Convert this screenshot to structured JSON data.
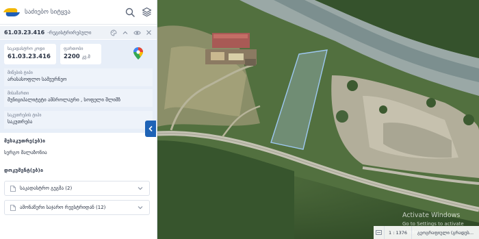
{
  "search": {
    "placeholder": "საძიებო სიტყვა"
  },
  "parcel": {
    "code": "61.03.23.416",
    "type": "-რეგისტრირებული"
  },
  "cards": {
    "cadastral_label": "საკადასტრო კოდი",
    "cadastral_value": "61.03.23.416",
    "area_label": "ფართობი",
    "area_value": "2200",
    "area_unit": "კვ.მ"
  },
  "details": [
    {
      "label": "მიწების ტიპი",
      "value": "არასასოფლო სამეურნეო"
    },
    {
      "label": "მისამართი",
      "value": "მუნიციპალიტეტი ამბროლაური , სოფელი შლიმზ"
    },
    {
      "label": "საკუთრების ტიპი",
      "value": "საკუთრება"
    }
  ],
  "owner_section": {
    "title": "მესაკუთრე(ებ)ი",
    "name": "სერგო მალაზონია"
  },
  "documents_section": {
    "title": "დოკუმენტ(ებ)ი",
    "items": [
      {
        "label": "საკადასტრო გეგმა (2)"
      },
      {
        "label": "ამონაწერი საჯარო რეესტრიდან (12)"
      }
    ]
  },
  "map": {
    "watermark_title": "Activate Windows",
    "watermark_sub": "Go to Settings to activate Windows.",
    "scale": "1 : 1376",
    "coord_label": "გეოგრაფიული (გრადუს..."
  },
  "colors": {
    "accent": "#1e63b6",
    "brand_yellow": "#f2b705",
    "brand_blue": "#1f5fb8",
    "parcel_outline": "#9ec8f2"
  },
  "icons": [
    "search-icon",
    "layers-icon",
    "palette-icon",
    "chevron-up-icon",
    "eye-icon",
    "close-icon",
    "google-maps-icon",
    "chevron-left-icon",
    "document-icon",
    "chevron-down-icon",
    "map-settings-icon"
  ]
}
